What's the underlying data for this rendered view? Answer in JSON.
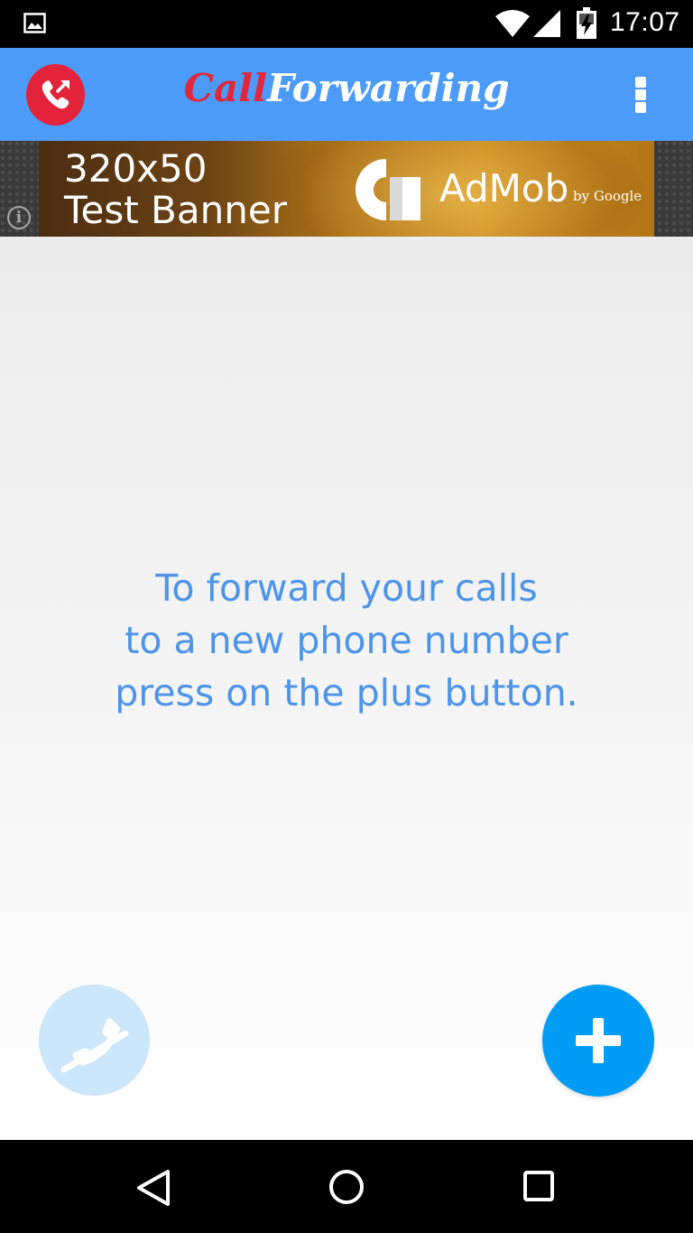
{
  "status_bar": {
    "time": "17:07",
    "icons": [
      "gallery-icon",
      "wifi-icon",
      "cell-signal-icon",
      "battery-charging-icon"
    ]
  },
  "app_bar": {
    "title_part1": "Call",
    "title_part2": "Forwarding",
    "logo_icon": "phone-forward-icon",
    "menu_icon": "overflow-menu-icon",
    "colors": {
      "background": "#4d9bf8",
      "logo": "#e2233a"
    }
  },
  "ad_banner": {
    "line1": "320x50",
    "line2": "Test Banner",
    "brand": "AdMob",
    "by": "by Google",
    "info_icon": "i"
  },
  "content": {
    "hint_lines": [
      "To forward your calls",
      "to a new phone number",
      "press on the plus button."
    ],
    "hint_color": "#4d94e8"
  },
  "fabs": {
    "call_icon": "phone-off-icon",
    "add_icon": "plus-icon",
    "add_color": "#039cf5",
    "call_color": "#cce6fb"
  },
  "nav_bar": {
    "icons": [
      "back-icon",
      "home-icon",
      "recents-icon"
    ]
  }
}
